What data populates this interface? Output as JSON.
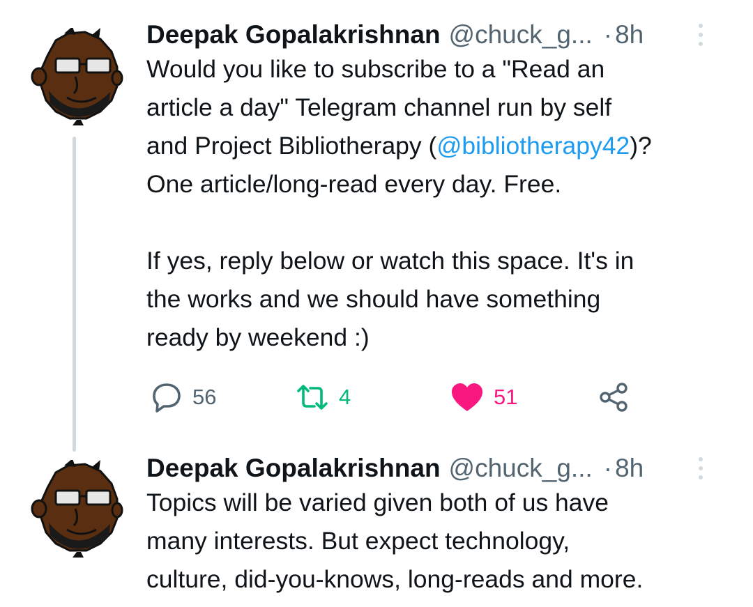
{
  "tweets": [
    {
      "author_name": "Deepak Gopalakrishnan",
      "handle": "@chuck_g...",
      "separator": "·",
      "time": "8h",
      "lines": [
        {
          "segments": [
            {
              "text": "Would you like to subscribe to a \"Read an"
            }
          ]
        },
        {
          "segments": [
            {
              "text": "article a day\" Telegram channel run by self"
            }
          ]
        },
        {
          "segments": [
            {
              "text": "and Project Bibliotherapy ("
            },
            {
              "text": "@bibliotherapy42",
              "mention": true
            },
            {
              "text": ")?"
            }
          ]
        },
        {
          "segments": [
            {
              "text": "One article/long-read every day. Free."
            }
          ]
        },
        {
          "gap": true
        },
        {
          "segments": [
            {
              "text": "If yes, reply below or watch this space. It's in"
            }
          ]
        },
        {
          "segments": [
            {
              "text": "the works and we should have something"
            }
          ]
        },
        {
          "segments": [
            {
              "text": "ready by weekend :)"
            }
          ]
        }
      ],
      "actions": {
        "replies": "56",
        "retweets": "4",
        "likes": "51",
        "liked": true
      }
    },
    {
      "author_name": "Deepak Gopalakrishnan",
      "handle": "@chuck_g...",
      "separator": "·",
      "time": "8h",
      "lines": [
        {
          "segments": [
            {
              "text": "Topics will be varied given both of us have"
            }
          ]
        },
        {
          "segments": [
            {
              "text": "many interests. But expect technology,"
            }
          ]
        },
        {
          "segments": [
            {
              "text": "culture, did-you-knows, long-reads and more."
            }
          ]
        }
      ]
    }
  ],
  "icons": {
    "avatar": "cartoon-avatar-icon",
    "more": "more-vertical-icon",
    "reply": "reply-bubble-icon",
    "retweet": "retweet-icon",
    "like": "heart-icon",
    "share": "share-icon"
  },
  "colors": {
    "text": "#0f1419",
    "secondary": "#536471",
    "link": "#1d9bf0",
    "like": "#f91880",
    "retweet": "#00ba7c",
    "thread_line": "#cfd9de"
  }
}
